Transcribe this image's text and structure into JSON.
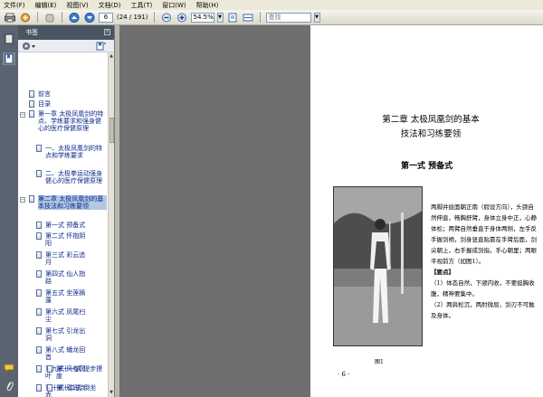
{
  "menu": [
    "文件(F)",
    "编辑(E)",
    "视图(V)",
    "文档(D)",
    "工具(T)",
    "窗口(W)",
    "帮助(H)"
  ],
  "toolbar": {
    "page_current": "6",
    "page_total": "(24 / 191)",
    "zoom": "54.5%",
    "search_placeholder": "查找"
  },
  "panel": {
    "title": "书签",
    "close_glyph": "x"
  },
  "bookmarks": [
    {
      "text": "前言"
    },
    {
      "text": "目录"
    },
    {
      "text": "第一章 太极凤凰剑的特点、学练要求和强身健心的医疗保健原理"
    },
    {
      "text": "一、太极凤凰剑的特点和学练要求"
    },
    {
      "text": "二、太极拳运动强身健心的医疗保健原理"
    },
    {
      "text": "第二章 太极凤凰剑的基本技法和习练要领"
    },
    {
      "text": "第一式 预备式"
    },
    {
      "text": "第二式 怀抱阴阳"
    },
    {
      "text": "第三式 彩云追月"
    },
    {
      "text": "第四式 仙人指路"
    },
    {
      "text": "第五式 坐莲摘蓬"
    },
    {
      "text": "第六式 凤尾扫尘"
    },
    {
      "text": "第七式 引龙出洞"
    },
    {
      "text": "第八式 蟠龙回首"
    },
    {
      "text": "第九式 风卷荷叶"
    },
    {
      "text": "第十式 眉间点赤"
    },
    {
      "text": "第十一式 提步撩崖"
    },
    {
      "text": "第十二式 倒坐"
    }
  ],
  "document": {
    "chapter_line1": "第二章   太极凤凰剑的基本",
    "chapter_line2": "技法和习练要领",
    "section": "第一式   预备式",
    "body": [
      "两脚并拢面朝正南（假设方向），头颈自然伸直，畅胸舒臂，身体立身中正，心静体松；两臂自然垂直于身体两侧，左手反手握剑柄，剑身竖直贴靠在手臂后面，剑尖朝上，右手握成剑指，手心朝里；两眼平视前方（如图1）。"
    ],
    "key_label": "【要点】",
    "points": [
      "（1）体态自然，下颌内收，不要挺胸收腹，精神要集中。",
      "（2）两肩松沉，两肘微屈，剑刃不可触及身体。"
    ],
    "caption": "图1",
    "page_number": "· 6 ·"
  }
}
